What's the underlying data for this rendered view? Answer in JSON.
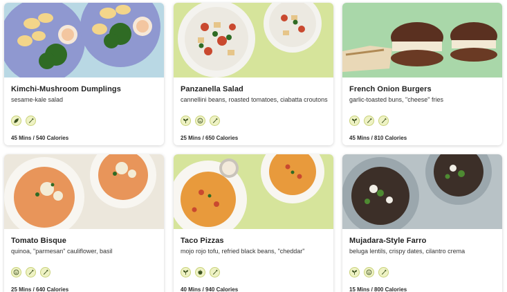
{
  "recipes": [
    {
      "title": "Kimchi-Mushroom Dumplings",
      "subtitle": "sesame-kale salad",
      "meta": "45 Mins / 540 Calories",
      "tags": [
        "leaf-icon",
        "carrot-icon"
      ]
    },
    {
      "title": "Panzanella Salad",
      "subtitle": "cannellini beans, roasted tomatoes, ciabatta croutons",
      "meta": "25 Mins / 650 Calories",
      "tags": [
        "sprout-icon",
        "smile-icon",
        "carrot-icon"
      ]
    },
    {
      "title": "French Onion Burgers",
      "subtitle": "garlic-toasted buns, \"cheese\" fries",
      "meta": "45 Mins / 810 Calories",
      "tags": [
        "sprout-icon",
        "carrot-icon",
        "carrot-icon"
      ]
    },
    {
      "title": "Tomato Bisque",
      "subtitle": "quinoa, \"parmesan\" cauliflower, basil",
      "meta": "25 Mins / 640 Calories",
      "tags": [
        "smile-icon",
        "carrot-icon",
        "carrot-icon"
      ]
    },
    {
      "title": "Taco Pizzas",
      "subtitle": "mojo rojo tofu, refried black beans, \"cheddar\"",
      "meta": "40 Mins / 940 Calories",
      "tags": [
        "sprout-icon",
        "apple-icon",
        "carrot-icon"
      ]
    },
    {
      "title": "Mujadara-Style Farro",
      "subtitle": "beluga lentils, crispy dates, cilantro crema",
      "meta": "15 Mins / 800 Calories",
      "tags": [
        "sprout-icon",
        "smile-icon",
        "carrot-icon"
      ]
    }
  ],
  "colors": {
    "tag_bg": "#eef2c4",
    "tag_border": "#c9d27a",
    "icon": "#3d5220"
  }
}
